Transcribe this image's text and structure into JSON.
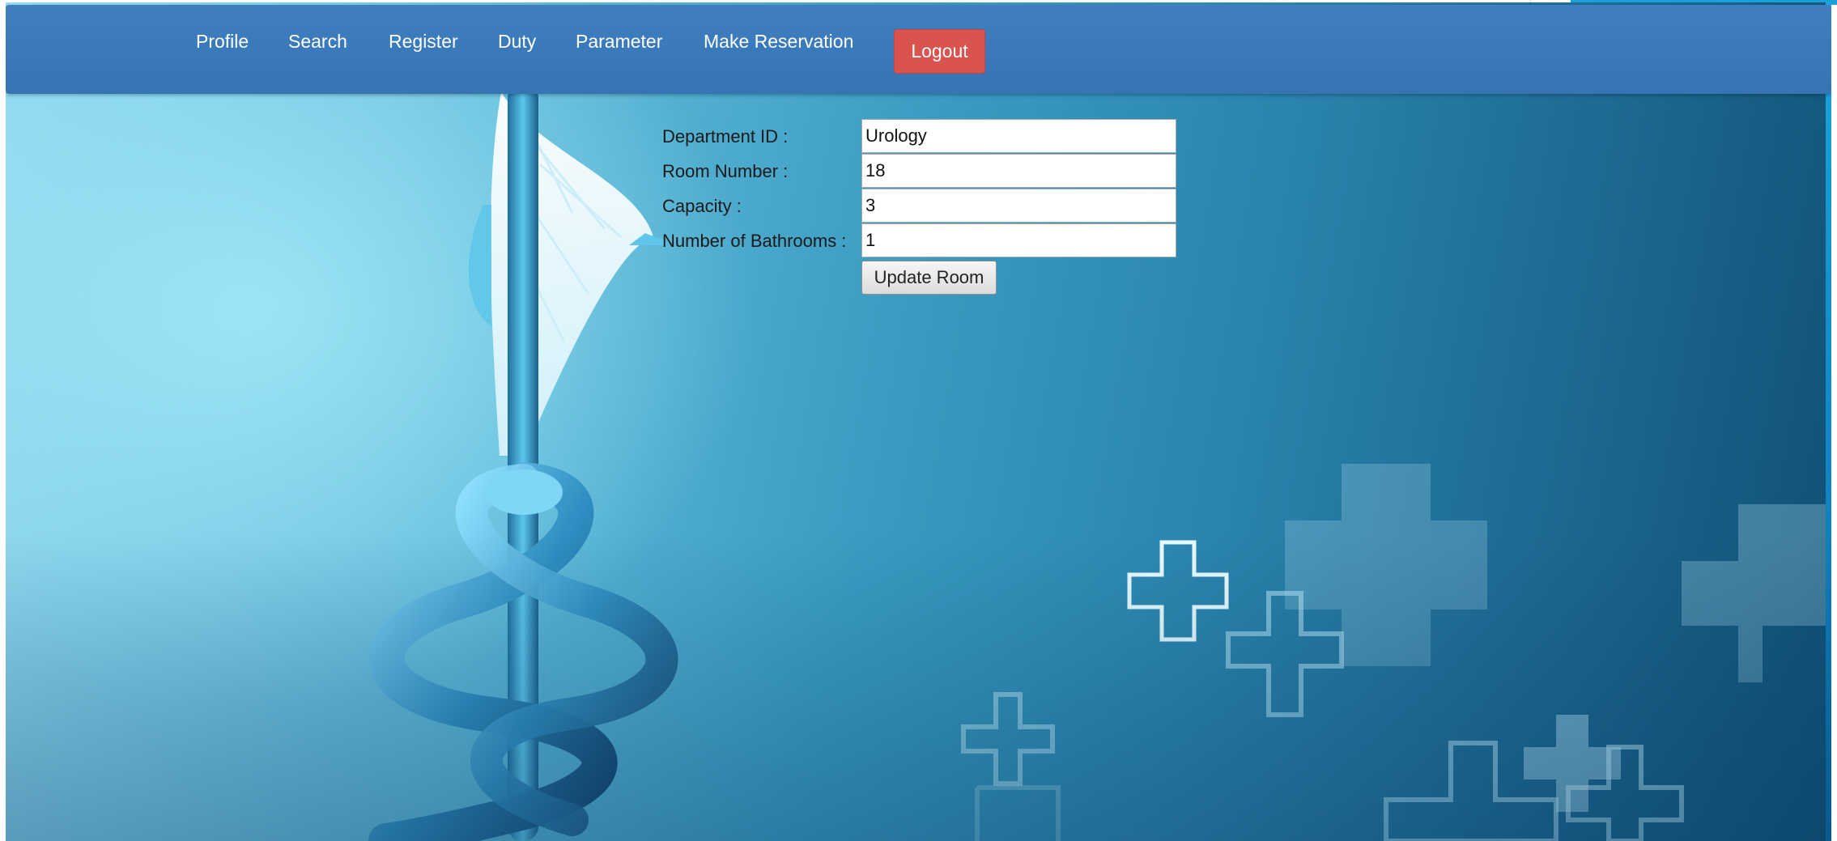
{
  "nav": {
    "items": [
      {
        "label": "Profile"
      },
      {
        "label": "Search"
      },
      {
        "label": "Register"
      },
      {
        "label": "Duty"
      },
      {
        "label": "Parameter"
      },
      {
        "label": "Make Reservation"
      }
    ],
    "logout_label": "Logout"
  },
  "form": {
    "department": {
      "label": "Department ID :",
      "value": "Urology"
    },
    "room_number": {
      "label": "Room Number :",
      "value": "18"
    },
    "capacity": {
      "label": "Capacity :",
      "value": "3"
    },
    "bathrooms": {
      "label": "Number of Bathrooms :",
      "value": "1"
    },
    "submit_label": "Update Room"
  },
  "colors": {
    "navbar": "#3674b4",
    "logout": "#d9534f",
    "background_light": "#8fd8ef",
    "background_dark": "#0f4e72"
  },
  "background": {
    "description_icons": [
      "caduceus-icon",
      "medical-cross-icon"
    ]
  }
}
